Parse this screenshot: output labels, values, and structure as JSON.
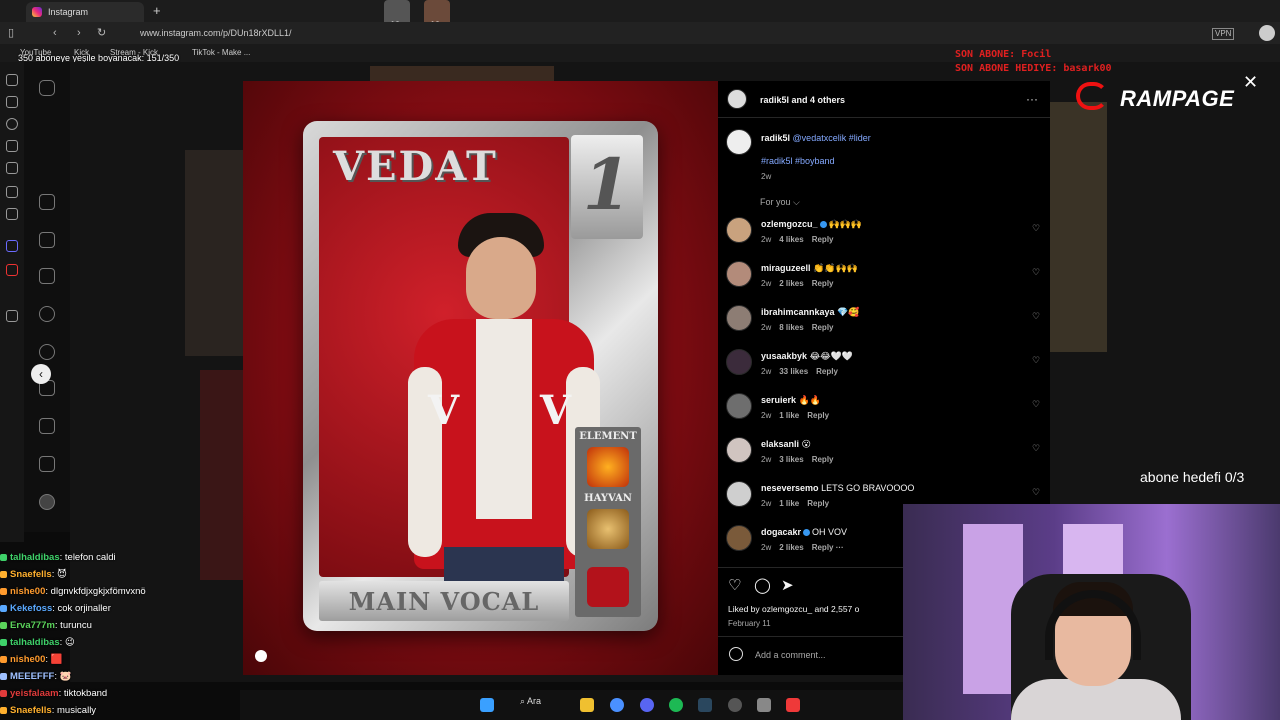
{
  "browser": {
    "tab_title": "Instagram",
    "new_tab": "+",
    "url": "www.instagram.com/p/DUn18rXDLL1/",
    "bookmarks": [
      "YouTube",
      "Kick",
      "Stream - Kick",
      "TikTok - Make ..."
    ],
    "profile_badges": [
      "12",
      "12"
    ]
  },
  "overlay": {
    "top_left_counter": "350 aboneye yeşile boyanacak: 151/350",
    "sub_alert_1": "SON ABONE: Focil",
    "sub_alert_2": "SON ABONE HEDIYE: basark00",
    "rampage_label": "RAMPAGE",
    "goal_text": "abone hedefi 0/3"
  },
  "post": {
    "card_name": "VEDAT",
    "card_number": "1",
    "card_element_label": "ELEMENT",
    "card_animal_label": "HAYVAN",
    "card_role": "MAIN VOCAL",
    "jacket_letter": "V"
  },
  "panel": {
    "header": "radik5l and 4 others",
    "more": "···",
    "caption_user": "radik5l",
    "caption_mention": "@vedatxcelik #lider",
    "caption_tags": "#radik5l #boyband",
    "caption_time": "2w",
    "for_you": "For you ⌵",
    "comments": [
      {
        "user": "ozlemgozcu_",
        "verified": true,
        "text": "🙌🙌🙌",
        "time": "2w",
        "likes": "4 likes",
        "reply": "Reply"
      },
      {
        "user": "miraguzeell",
        "verified": false,
        "text": "👏👏🙌🙌",
        "time": "2w",
        "likes": "2 likes",
        "reply": "Reply"
      },
      {
        "user": "ibrahimcannkaya",
        "verified": false,
        "text": "💎🥰",
        "time": "2w",
        "likes": "8 likes",
        "reply": "Reply"
      },
      {
        "user": "yusaakbyk",
        "verified": false,
        "text": "😂😂🤍🤍",
        "time": "2w",
        "likes": "33 likes",
        "reply": "Reply"
      },
      {
        "user": "seruierk",
        "verified": false,
        "text": "🔥🔥",
        "time": "2w",
        "likes": "1 like",
        "reply": "Reply"
      },
      {
        "user": "elaksanli",
        "verified": false,
        "text": "😮",
        "time": "2w",
        "likes": "3 likes",
        "reply": "Reply"
      },
      {
        "user": "neseversemo",
        "verified": false,
        "text": "LETS GO BRAVOOOO",
        "time": "2w",
        "likes": "1 like",
        "reply": "Reply"
      },
      {
        "user": "dogacakr",
        "verified": true,
        "text": "OH VOV",
        "time": "2w",
        "likes": "2 likes",
        "reply": "Reply ···"
      }
    ],
    "liked_by": "Liked by ozlemgozcu_ and 2,557 o",
    "date": "February 11",
    "add_comment": "Add a comment..."
  },
  "chat": [
    {
      "user": "talhaldibas",
      "color": "#3fd26a",
      "text": ": telefon caldi"
    },
    {
      "user": "Snaefells",
      "color": "#ffb02e",
      "text": ": 😈"
    },
    {
      "user": "nishe00",
      "color": "#ff9b2e",
      "text": ": dlgnvkfdjxgkjxfömvxnö"
    },
    {
      "user": "Kekefoss",
      "color": "#5aa9ff",
      "text": ": cok orjinaller"
    },
    {
      "user": "Erva777m",
      "color": "#5bd35b",
      "text": ": turuncu"
    },
    {
      "user": "talhaldibas",
      "color": "#3fd26a",
      "text": ": 😉"
    },
    {
      "user": "nishe00",
      "color": "#ff9b2e",
      "text": ": 🟥"
    },
    {
      "user": "MEEEFFF",
      "color": "#9ec0ff",
      "text": ": 🐷"
    },
    {
      "user": "yeisfalaam",
      "color": "#e03b3b",
      "text": ": tiktokband"
    },
    {
      "user": "Snaefells",
      "color": "#ffb02e",
      "text": ": musically"
    }
  ],
  "taskbar": {
    "search_label": "Ara"
  },
  "colors": {
    "accent_blue": "#84a9ff",
    "alert_red": "#e02020"
  }
}
